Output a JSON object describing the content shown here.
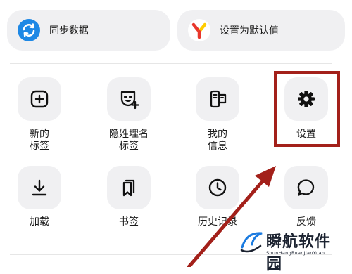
{
  "quick_actions": {
    "sync_label": "同步数据",
    "set_default_label": "设置为默认值"
  },
  "grid": {
    "new_tab": [
      "新的",
      "标签"
    ],
    "incognito": [
      "隐姓埋名",
      "标签"
    ],
    "my_info": [
      "我的",
      "信息"
    ],
    "settings": "设置",
    "downloads": "加载",
    "bookmarks": "书签",
    "history": "历史记录",
    "feedback": "反馈"
  },
  "watermark": {
    "text": "瞬航软件园",
    "sub": "ShunHangRuanJianYuan"
  },
  "colors": {
    "sync_blue": "#1e88e5",
    "yandex_red": "#e8372c",
    "yandex_yellow": "#ffcc00",
    "highlight": "#a3201a"
  }
}
